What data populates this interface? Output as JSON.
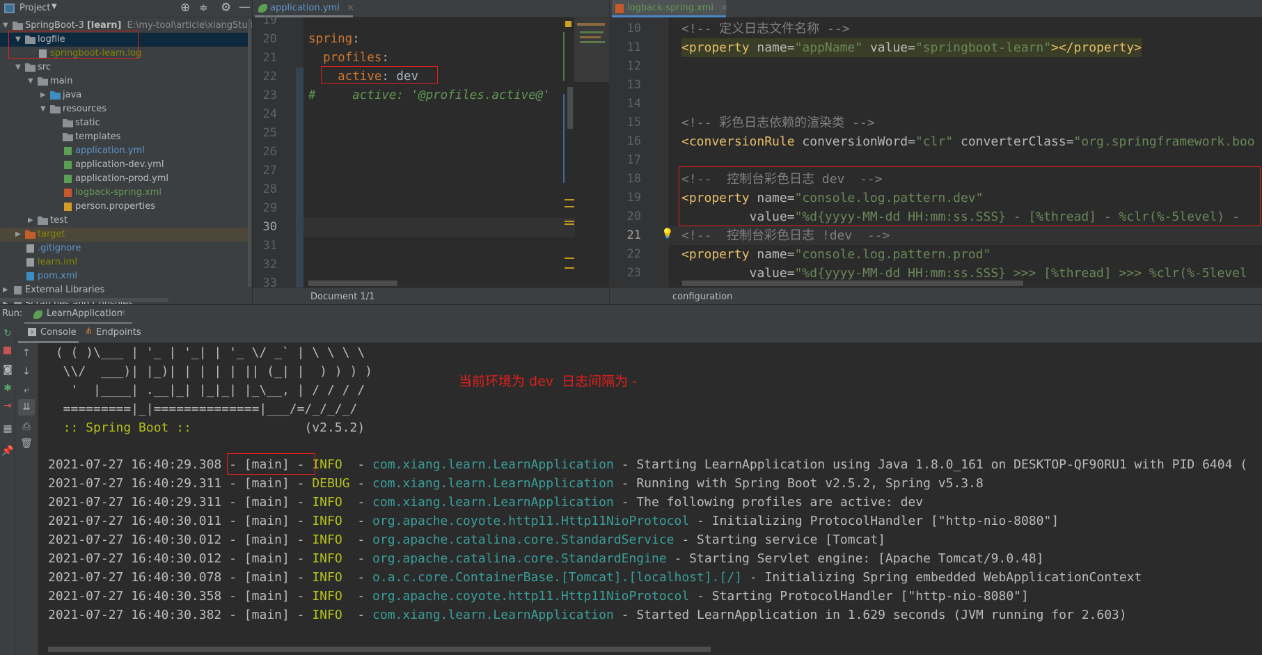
{
  "project": {
    "title": "Project",
    "tree": [
      {
        "label": "SpringBoot-3",
        "bold": "[learn]",
        "path": "E:\\my-tool\\article\\xiangStudy\\lab-s",
        "level": 0,
        "arrow": "down",
        "icon": "module-icon",
        "color": "#bbbbbb"
      },
      {
        "label": "logfile",
        "level": 1,
        "arrow": "down",
        "icon": "folder-icon",
        "color": "#bbbbbb",
        "state": "selected"
      },
      {
        "label": "springboot-learn.log",
        "level": 2,
        "icon": "text-file-icon",
        "color": "#848504"
      },
      {
        "label": "src",
        "level": 1,
        "arrow": "down",
        "icon": "folder-icon",
        "color": "#bbbbbb"
      },
      {
        "label": "main",
        "level": 2,
        "arrow": "down",
        "icon": "folder-icon",
        "color": "#bbbbbb"
      },
      {
        "label": "java",
        "level": 3,
        "arrow": "right",
        "icon": "source-folder-icon",
        "color": "#bbbbbb"
      },
      {
        "label": "resources",
        "level": 3,
        "arrow": "down",
        "icon": "resources-folder-icon",
        "color": "#bbbbbb"
      },
      {
        "label": "static",
        "level": 4,
        "icon": "folder-icon",
        "color": "#bbbbbb"
      },
      {
        "label": "templates",
        "level": 4,
        "icon": "folder-icon",
        "color": "#bbbbbb"
      },
      {
        "label": "application.yml",
        "level": 4,
        "icon": "spring-config-icon",
        "color": "#5d94c9"
      },
      {
        "label": "application-dev.yml",
        "level": 4,
        "icon": "spring-config-icon",
        "color": "#bbbbbb"
      },
      {
        "label": "application-prod.yml",
        "level": 4,
        "icon": "spring-config-icon",
        "color": "#bbbbbb"
      },
      {
        "label": "logback-spring.xml",
        "level": 4,
        "icon": "xml-file-icon",
        "color": "#629755"
      },
      {
        "label": "person.properties",
        "level": 4,
        "icon": "properties-file-icon",
        "color": "#bbbbbb"
      },
      {
        "label": "test",
        "level": 2,
        "arrow": "right",
        "icon": "folder-icon",
        "color": "#bbbbbb"
      },
      {
        "label": "target",
        "level": 1,
        "arrow": "right",
        "icon": "excluded-folder-icon",
        "color": "#848504",
        "state": "target"
      },
      {
        "label": ".gitignore",
        "level": 1,
        "icon": "gitignore-file-icon",
        "color": "#5d94c9"
      },
      {
        "label": "learn.iml",
        "level": 1,
        "icon": "iml-file-icon",
        "color": "#848504"
      },
      {
        "label": "pom.xml",
        "level": 1,
        "icon": "maven-icon",
        "color": "#5d94c9"
      },
      {
        "label": "External Libraries",
        "level": 0,
        "arrow": "right",
        "icon": "libraries-icon",
        "color": "#bbbbbb"
      },
      {
        "label": "Scratches and Consoles",
        "level": 0,
        "arrow": "right",
        "icon": "scratches-icon",
        "color": "#bbbbbb"
      }
    ]
  },
  "editor_left": {
    "tab": "application.yml",
    "status": "Document 1/1",
    "current_line": 30,
    "lines": [
      {
        "n": "19",
        "t": []
      },
      {
        "n": "20",
        "t": [
          [
            "spring",
            "key"
          ],
          [
            ":",
            "val"
          ]
        ]
      },
      {
        "n": "21",
        "t": [
          [
            "  profiles",
            "key"
          ],
          [
            ":",
            "val"
          ]
        ]
      },
      {
        "n": "22",
        "t": [
          [
            "    active",
            "key"
          ],
          [
            ": dev",
            "val"
          ]
        ]
      },
      {
        "n": "23",
        "t": [
          [
            "#     active: '@profiles.active@'",
            "cmt"
          ]
        ]
      },
      {
        "n": "24",
        "t": []
      },
      {
        "n": "25",
        "t": []
      },
      {
        "n": "26",
        "t": []
      },
      {
        "n": "27",
        "t": []
      },
      {
        "n": "28",
        "t": []
      },
      {
        "n": "29",
        "t": []
      },
      {
        "n": "30",
        "t": []
      },
      {
        "n": "31",
        "t": []
      },
      {
        "n": "32",
        "t": []
      },
      {
        "n": "33",
        "t": []
      }
    ]
  },
  "editor_right": {
    "tab": "logback-spring.xml",
    "status": "configuration",
    "current_line": 21,
    "lines": [
      {
        "n": "10",
        "t": [
          [
            "<!-- 定义日志文件名称 -->",
            "xcmt"
          ]
        ]
      },
      {
        "n": "11",
        "hl": true,
        "t": [
          [
            "<property ",
            "tag"
          ],
          [
            "name=",
            "attr"
          ],
          [
            "\"appName\"",
            "str"
          ],
          [
            " value=",
            "attr"
          ],
          [
            "\"springboot-learn\"",
            "str"
          ],
          [
            "></property>",
            "tag"
          ]
        ]
      },
      {
        "n": "12",
        "t": []
      },
      {
        "n": "13",
        "t": []
      },
      {
        "n": "14",
        "t": []
      },
      {
        "n": "15",
        "t": [
          [
            "<!-- 彩色日志依赖的渲染类 -->",
            "xcmt"
          ]
        ]
      },
      {
        "n": "16",
        "t": [
          [
            "<conversionRule ",
            "tag"
          ],
          [
            "conversionWord=",
            "attr"
          ],
          [
            "\"clr\"",
            "str"
          ],
          [
            " converterClass=",
            "attr"
          ],
          [
            "\"org.springframework.boo",
            "str"
          ]
        ]
      },
      {
        "n": "17",
        "t": []
      },
      {
        "n": "18",
        "t": [
          [
            "<!--  控制台彩色日志 dev  -->",
            "xcmt"
          ]
        ]
      },
      {
        "n": "19",
        "t": [
          [
            "<property ",
            "tag"
          ],
          [
            "name=",
            "attr"
          ],
          [
            "\"console.log.pattern.dev\"",
            "str"
          ]
        ]
      },
      {
        "n": "20",
        "t": [
          [
            "         value=",
            "attr"
          ],
          [
            "\"%d{yyyy-MM-dd HH:mm:ss.SSS} - [%thread] - %clr(%-5level) -",
            "str"
          ]
        ]
      },
      {
        "n": "21",
        "t": [
          [
            "<!--  控制台彩色日志 !dev  -->",
            "xcmt"
          ]
        ]
      },
      {
        "n": "22",
        "t": [
          [
            "<property ",
            "tag"
          ],
          [
            "name=",
            "attr"
          ],
          [
            "\"console.log.pattern.prod\"",
            "str"
          ]
        ]
      },
      {
        "n": "23",
        "t": [
          [
            "         value=",
            "attr"
          ],
          [
            "\"%d{yyyy-MM-dd HH:mm:ss.SSS} >>> [%thread] >>> %clr(%-5level",
            "str"
          ]
        ]
      }
    ]
  },
  "run": {
    "label": "Run:",
    "config": "LearnApplication",
    "tabs": [
      "Console",
      "Endpoints"
    ],
    "banner": [
      " ( ( )\\___ | '_ | '_| | '_ \\/ _` | \\ \\ \\ \\",
      "  \\\\/  ___)| |_)| | | | | || (_| |  ) ) ) )",
      "   '  |____| .__|_| |_|_| |_\\__, | / / / /",
      "  =========|_|==============|___/=/_/_/_/"
    ],
    "spring_boot": "  :: Spring Boot ::",
    "version": "(v2.5.2)",
    "annotation": "当前环境为 dev  日志间隔为 -",
    "logs": [
      {
        "ts": "2021-07-27 16:40:29.308",
        "thread": "[main]",
        "level": "INFO ",
        "logger": "com.xiang.learn.LearnApplication",
        "msg": "Starting LearnApplication using Java 1.8.0_161 on DESKTOP-QF90RU1 with PID 6404 ("
      },
      {
        "ts": "2021-07-27 16:40:29.311",
        "thread": "[main]",
        "level": "DEBUG",
        "logger": "com.xiang.learn.LearnApplication",
        "msg": "Running with Spring Boot v2.5.2, Spring v5.3.8"
      },
      {
        "ts": "2021-07-27 16:40:29.311",
        "thread": "[main]",
        "level": "INFO ",
        "logger": "com.xiang.learn.LearnApplication",
        "msg": "The following profiles are active: dev"
      },
      {
        "ts": "2021-07-27 16:40:30.011",
        "thread": "[main]",
        "level": "INFO ",
        "logger": "org.apache.coyote.http11.Http11NioProtocol",
        "msg": "Initializing ProtocolHandler [\"http-nio-8080\"]"
      },
      {
        "ts": "2021-07-27 16:40:30.012",
        "thread": "[main]",
        "level": "INFO ",
        "logger": "org.apache.catalina.core.StandardService",
        "msg": "Starting service [Tomcat]"
      },
      {
        "ts": "2021-07-27 16:40:30.012",
        "thread": "[main]",
        "level": "INFO ",
        "logger": "org.apache.catalina.core.StandardEngine",
        "msg": "Starting Servlet engine: [Apache Tomcat/9.0.48]"
      },
      {
        "ts": "2021-07-27 16:40:30.078",
        "thread": "[main]",
        "level": "INFO ",
        "logger": "o.a.c.core.ContainerBase.[Tomcat].[localhost].[/]",
        "msg": "Initializing Spring embedded WebApplicationContext"
      },
      {
        "ts": "2021-07-27 16:40:30.358",
        "thread": "[main]",
        "level": "INFO ",
        "logger": "org.apache.coyote.http11.Http11NioProtocol",
        "msg": "Starting ProtocolHandler [\"http-nio-8080\"]"
      },
      {
        "ts": "2021-07-27 16:40:30.382",
        "thread": "[main]",
        "level": "INFO ",
        "logger": "com.xiang.learn.LearnApplication",
        "msg": "Started LearnApplication in 1.629 seconds (JVM running for 2.603)"
      }
    ]
  },
  "colors": {
    "annotation": "#e0201e",
    "accent": "#4a88c7"
  }
}
